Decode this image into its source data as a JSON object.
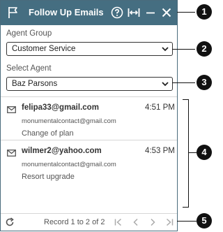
{
  "window": {
    "title": "Follow Up Emails"
  },
  "agent_group": {
    "label": "Agent Group",
    "selected": "Customer Service"
  },
  "select_agent": {
    "label": "Select Agent",
    "selected": "Baz Parsons"
  },
  "emails": [
    {
      "from": "felipa33@gmail.com",
      "time": "4:51 PM",
      "to": "monumentalcontact@gmail.com",
      "subject": "Change of plan"
    },
    {
      "from": "wilmer2@yahoo.com",
      "time": "4:53 PM",
      "to": "monumentalcontact@gmail.com",
      "subject": "Resort upgrade"
    }
  ],
  "footer": {
    "record_text": "Record 1 to 2 of 2"
  },
  "callouts": [
    "1",
    "2",
    "3",
    "4",
    "5"
  ],
  "colors": {
    "titlebar": "#456e81",
    "callout": "#111111"
  }
}
